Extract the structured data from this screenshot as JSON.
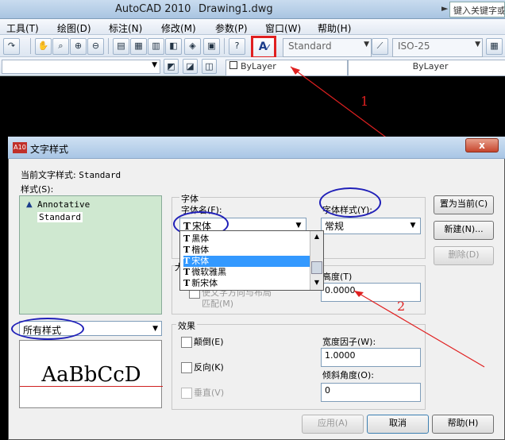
{
  "window": {
    "app_title": "AutoCAD 2010",
    "doc_title": "Drawing1.dwg",
    "search_hint": "键入关键字或",
    "search_arrow": "►"
  },
  "menu": [
    "工具(T)",
    "绘图(D)",
    "标注(N)",
    "修改(M)",
    "参数(P)",
    "窗口(W)",
    "帮助(H)"
  ],
  "toolbar": {
    "text_style_combo": "Standard",
    "dim_style_combo": "ISO-25",
    "bylayer_color": "ByLayer",
    "bylayer_linetype": "ByLayer"
  },
  "annotations": {
    "label_1": "1",
    "label_2": "2",
    "highlight_color": "#e02020",
    "circle_color": "#1f1fb8"
  },
  "dialog": {
    "title": "文字样式",
    "close_glyph": "x",
    "current_style_label": "当前文字样式: ",
    "current_style_value": "Standard",
    "styles_label": "样式(S):",
    "styles": [
      "Annotative",
      "Standard"
    ],
    "filter_value": "所有样式",
    "preview_text": "AaBbCcD",
    "font_group": "字体",
    "font_name_label": "字体名(F):",
    "font_name_value": "宋体",
    "font_style_label": "字体样式(Y):",
    "font_style_value": "常规",
    "font_options": [
      "黑体",
      "楷体",
      "宋体",
      "微软雅黑",
      "新宋体"
    ],
    "font_options_selected": "宋体",
    "size_group_partial": "大",
    "match_orientation": "使文字方向与布局",
    "match_orientation_2": "匹配(M)",
    "height_label": "高度(T)",
    "height_value": "0.0000",
    "effects_group": "效果",
    "upside_down": "颠倒(E)",
    "backwards": "反向(K)",
    "vertical": "垂直(V)",
    "width_factor_label": "宽度因子(W):",
    "width_factor_value": "1.0000",
    "oblique_label": "倾斜角度(O):",
    "oblique_value": "0",
    "btn_set_current": "置为当前(C)",
    "btn_new": "新建(N)...",
    "btn_delete": "删除(D)",
    "btn_apply": "应用(A)",
    "btn_cancel": "取消",
    "btn_help": "帮助(H)"
  }
}
